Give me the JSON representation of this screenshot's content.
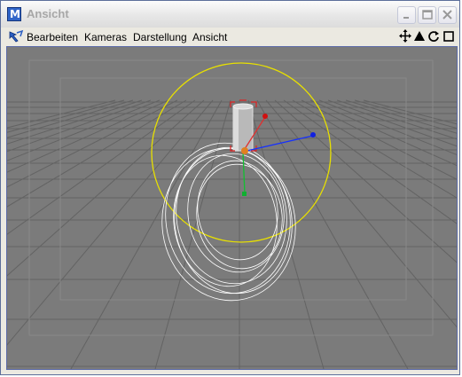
{
  "window": {
    "title": "Ansicht",
    "app_icon_letter": "M"
  },
  "menubar": {
    "items": [
      "Bearbeiten",
      "Kameras",
      "Darstellung",
      "Ansicht"
    ]
  },
  "viewport": {
    "background_color": "#7b7b7b",
    "grid_color": "#636363",
    "object_icons": [
      "move-view-icon",
      "zoom-view-icon",
      "rotate-view-icon",
      "toggle-view-icon"
    ]
  }
}
